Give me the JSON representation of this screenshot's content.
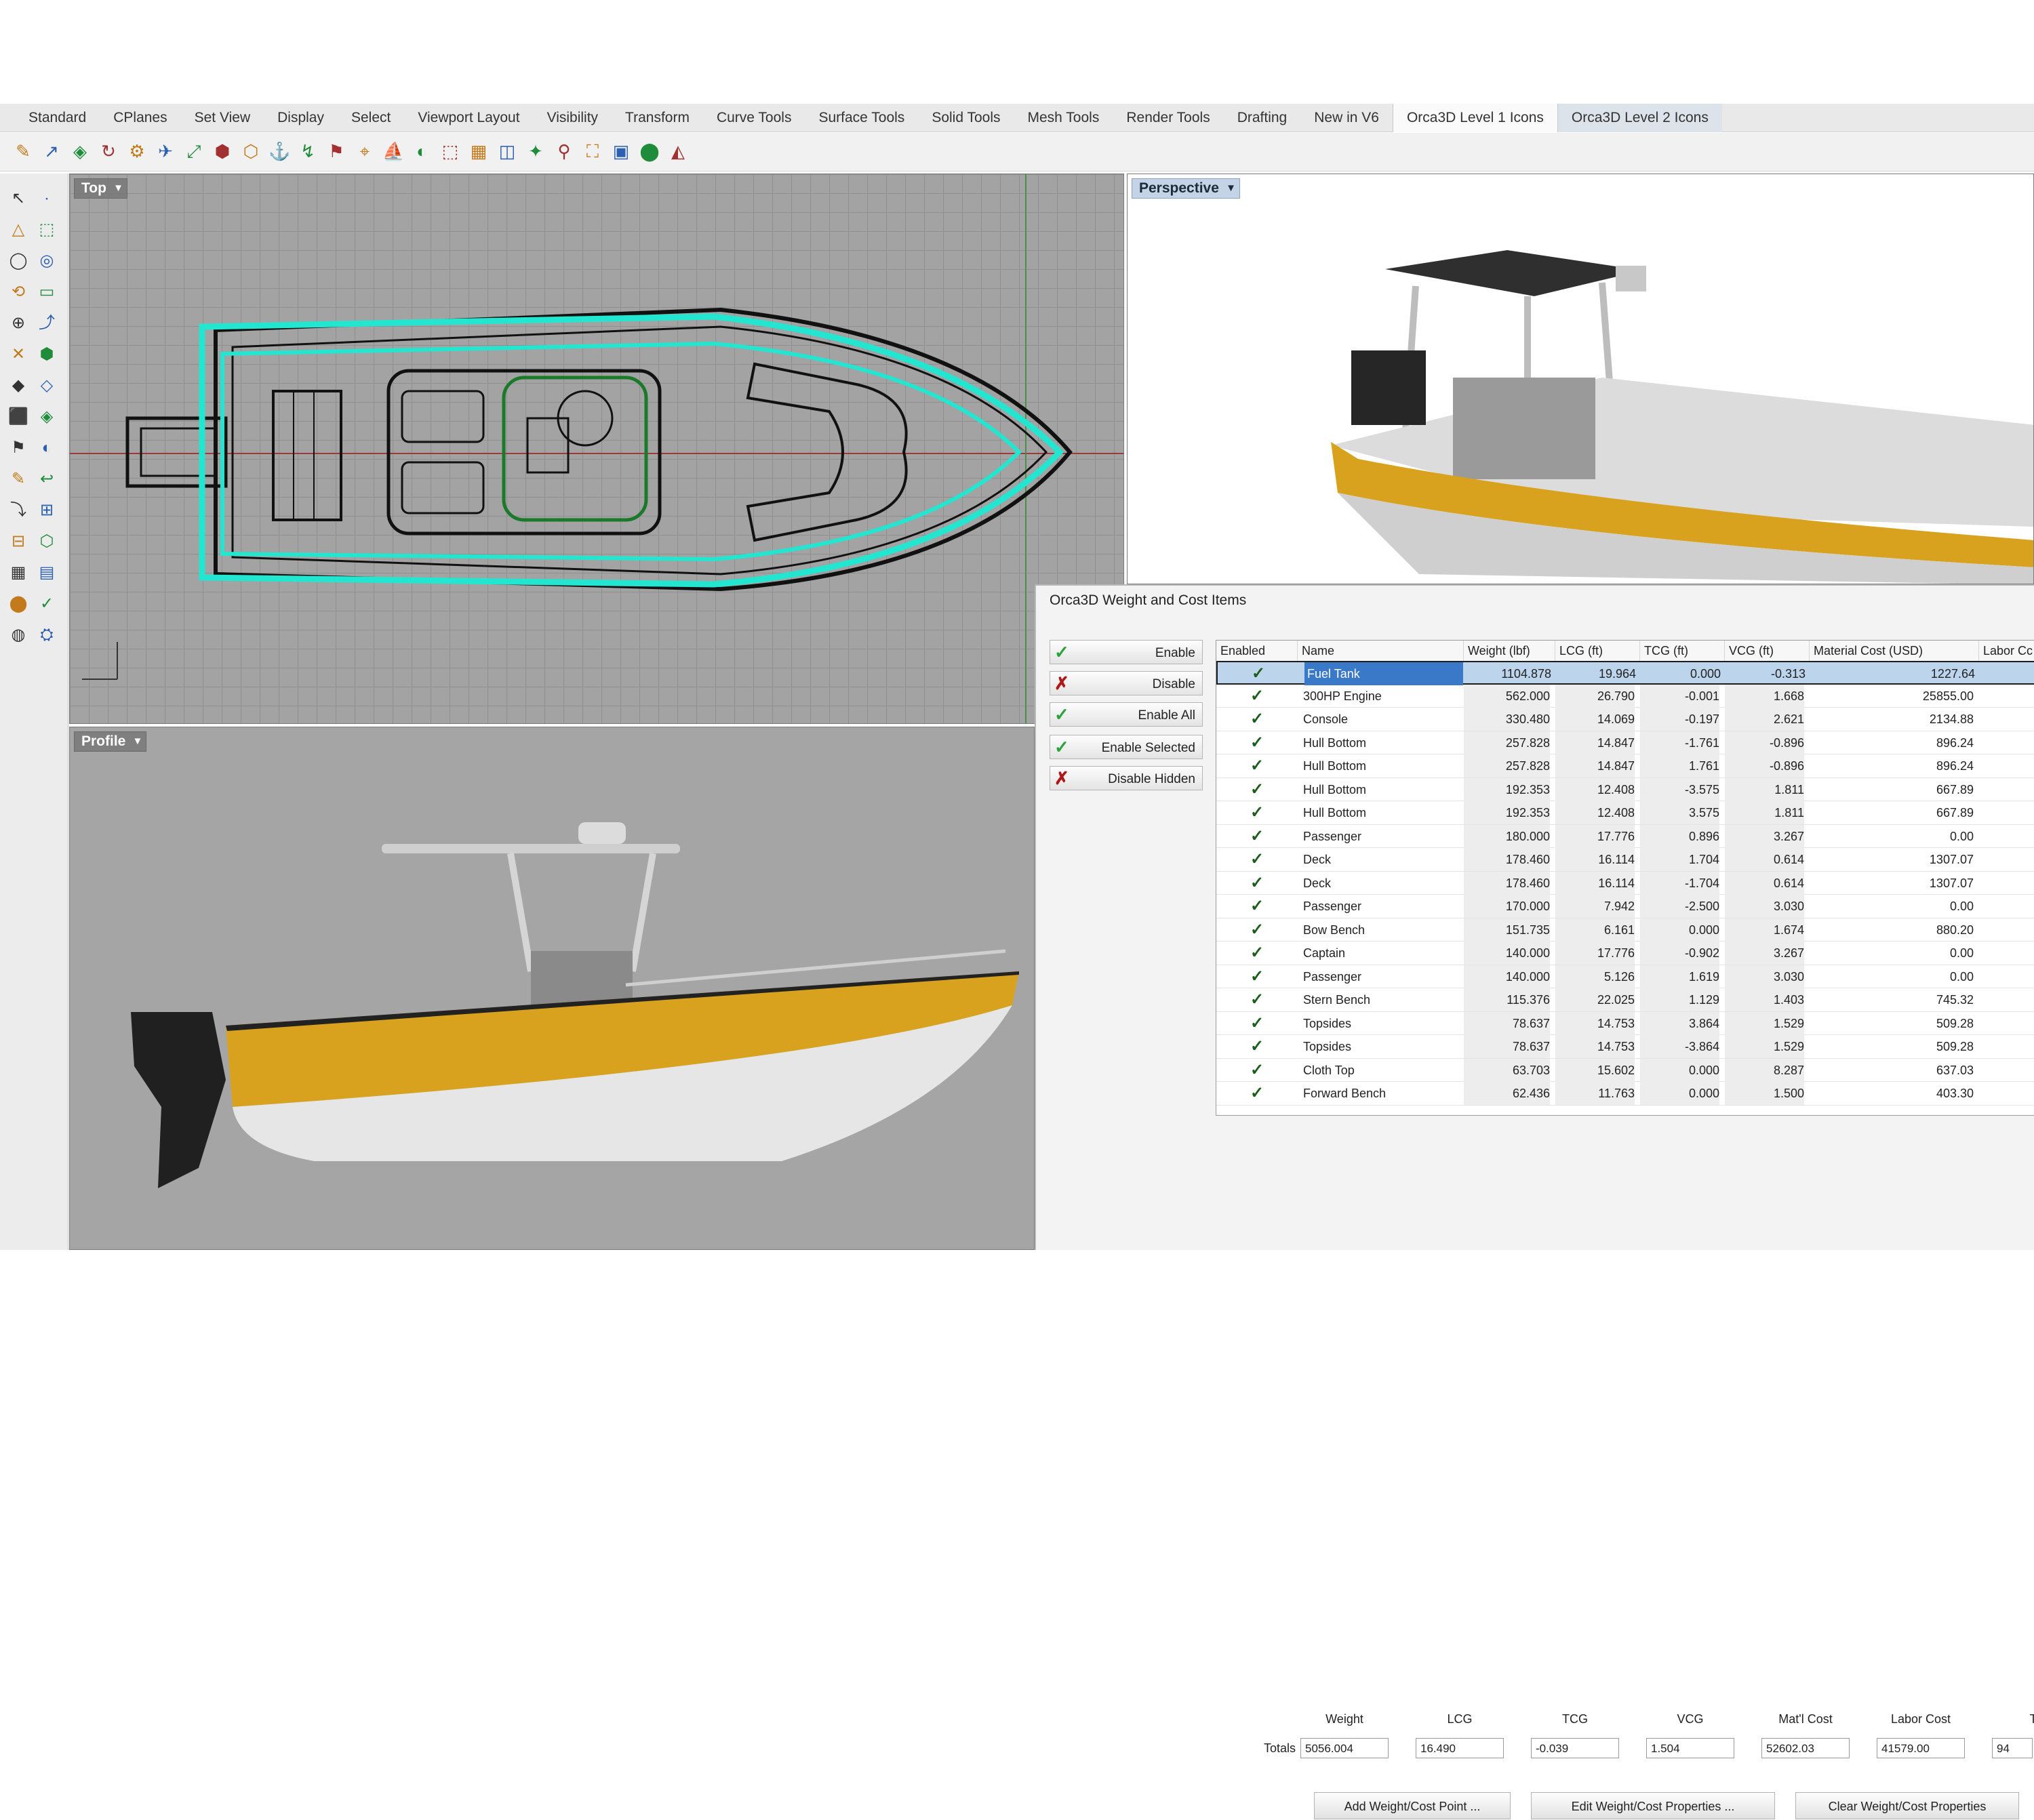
{
  "menu_tabs": [
    "Standard",
    "CPlanes",
    "Set View",
    "Display",
    "Select",
    "Viewport Layout",
    "Visibility",
    "Transform",
    "Curve Tools",
    "Surface Tools",
    "Solid Tools",
    "Mesh Tools",
    "Render Tools",
    "Drafting",
    "New in V6",
    "Orca3D Level 1 Icons",
    "Orca3D Level 2 Icons"
  ],
  "viewports": {
    "top": "Top",
    "perspective": "Perspective",
    "profile": "Profile"
  },
  "dialog": {
    "title": "Orca3D Weight and Cost Items",
    "side_buttons": [
      {
        "label": "Enable",
        "icon": "check-icon"
      },
      {
        "label": "Disable",
        "icon": "x-icon"
      },
      {
        "label": "Enable All",
        "icon": "check-icon"
      },
      {
        "label": "Enable Selected",
        "icon": "check-icon"
      },
      {
        "label": "Disable Hidden",
        "icon": "x-icon"
      }
    ],
    "columns": [
      "Enabled",
      "Name",
      "Weight (lbf)",
      "LCG (ft)",
      "TCG (ft)",
      "VCG (ft)",
      "Material Cost (USD)",
      "Labor Cc"
    ],
    "rows": [
      {
        "name": "Fuel Tank",
        "weight": "1104.878",
        "lcg": "19.964",
        "tcg": "0.000",
        "vcg": "-0.313",
        "mat": "1227.64"
      },
      {
        "name": "300HP Engine",
        "weight": "562.000",
        "lcg": "26.790",
        "tcg": "-0.001",
        "vcg": "1.668",
        "mat": "25855.00"
      },
      {
        "name": "Console",
        "weight": "330.480",
        "lcg": "14.069",
        "tcg": "-0.197",
        "vcg": "2.621",
        "mat": "2134.88"
      },
      {
        "name": "Hull Bottom",
        "weight": "257.828",
        "lcg": "14.847",
        "tcg": "-1.761",
        "vcg": "-0.896",
        "mat": "896.24"
      },
      {
        "name": "Hull Bottom",
        "weight": "257.828",
        "lcg": "14.847",
        "tcg": "1.761",
        "vcg": "-0.896",
        "mat": "896.24"
      },
      {
        "name": "Hull Bottom",
        "weight": "192.353",
        "lcg": "12.408",
        "tcg": "-3.575",
        "vcg": "1.811",
        "mat": "667.89"
      },
      {
        "name": "Hull Bottom",
        "weight": "192.353",
        "lcg": "12.408",
        "tcg": "3.575",
        "vcg": "1.811",
        "mat": "667.89"
      },
      {
        "name": "Passenger",
        "weight": "180.000",
        "lcg": "17.776",
        "tcg": "0.896",
        "vcg": "3.267",
        "mat": "0.00"
      },
      {
        "name": "Deck",
        "weight": "178.460",
        "lcg": "16.114",
        "tcg": "1.704",
        "vcg": "0.614",
        "mat": "1307.07"
      },
      {
        "name": "Deck",
        "weight": "178.460",
        "lcg": "16.114",
        "tcg": "-1.704",
        "vcg": "0.614",
        "mat": "1307.07"
      },
      {
        "name": "Passenger",
        "weight": "170.000",
        "lcg": "7.942",
        "tcg": "-2.500",
        "vcg": "3.030",
        "mat": "0.00"
      },
      {
        "name": "Bow Bench",
        "weight": "151.735",
        "lcg": "6.161",
        "tcg": "0.000",
        "vcg": "1.674",
        "mat": "880.20"
      },
      {
        "name": "Captain",
        "weight": "140.000",
        "lcg": "17.776",
        "tcg": "-0.902",
        "vcg": "3.267",
        "mat": "0.00"
      },
      {
        "name": "Passenger",
        "weight": "140.000",
        "lcg": "5.126",
        "tcg": "1.619",
        "vcg": "3.030",
        "mat": "0.00"
      },
      {
        "name": "Stern Bench",
        "weight": "115.376",
        "lcg": "22.025",
        "tcg": "1.129",
        "vcg": "1.403",
        "mat": "745.32"
      },
      {
        "name": "Topsides",
        "weight": "78.637",
        "lcg": "14.753",
        "tcg": "3.864",
        "vcg": "1.529",
        "mat": "509.28"
      },
      {
        "name": "Topsides",
        "weight": "78.637",
        "lcg": "14.753",
        "tcg": "-3.864",
        "vcg": "1.529",
        "mat": "509.28"
      },
      {
        "name": "Cloth Top",
        "weight": "63.703",
        "lcg": "15.602",
        "tcg": "0.000",
        "vcg": "8.287",
        "mat": "637.03"
      },
      {
        "name": "Forward Bench",
        "weight": "62.436",
        "lcg": "11.763",
        "tcg": "0.000",
        "vcg": "1.500",
        "mat": "403.30"
      }
    ],
    "totals": {
      "label": "Totals",
      "headers": [
        "Weight",
        "LCG",
        "TCG",
        "VCG",
        "Mat'l Cost",
        "Labor Cost",
        "To"
      ],
      "values": [
        "5056.004",
        "16.490",
        "-0.039",
        "1.504",
        "52602.03",
        "41579.00",
        "94"
      ]
    },
    "bottom_buttons": [
      "Add Weight/Cost Point ...",
      "Edit Weight/Cost Properties ...",
      "Clear Weight/Cost Properties"
    ]
  },
  "colors": {
    "hull_yellow": "#d8a21e",
    "highlight_cyan": "#23e6d0",
    "check_green": "#27a33a",
    "x_red": "#b01818",
    "selection_blue": "#bcd4ec"
  }
}
